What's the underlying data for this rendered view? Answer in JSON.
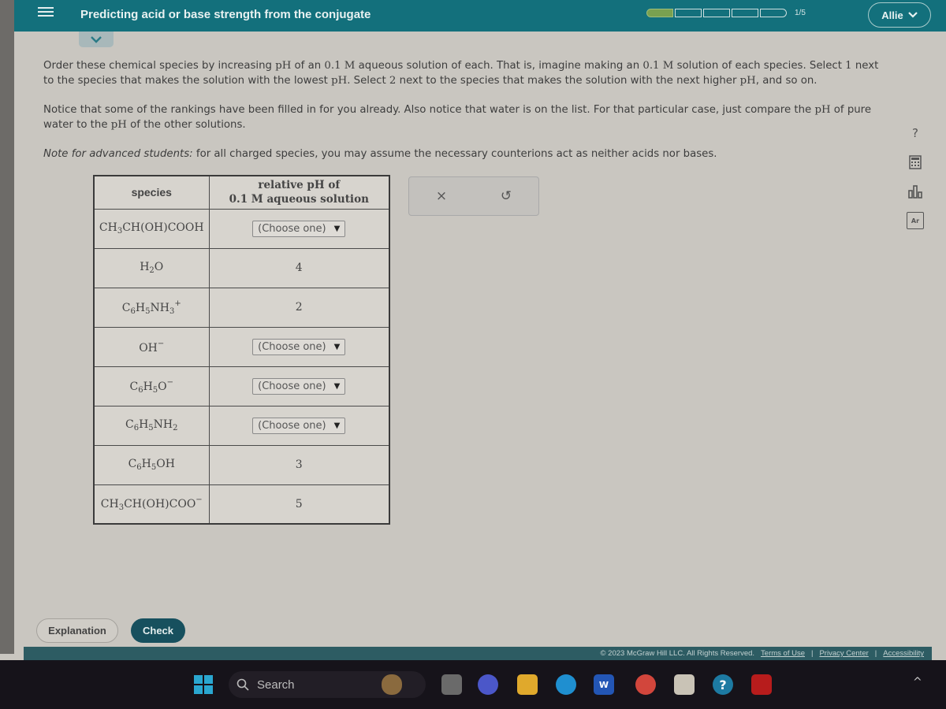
{
  "header": {
    "title": "Predicting acid or base strength from the conjugate",
    "progress": {
      "current": 1,
      "total": 5,
      "label": "1/5"
    },
    "user": "Allie",
    "colors": {
      "header_bg": "#13707c",
      "progress_done": "#79a150",
      "check_button": "#17505e"
    }
  },
  "instructions": {
    "p1_a": "Order these chemical species by increasing ",
    "p1_ph": "pH",
    "p1_b": " of an ",
    "p1_conc": "0.1 M",
    "p1_c": " aqueous solution of each. That is, imagine making an ",
    "p1_conc2": "0.1 M",
    "p1_d": " solution of each species. Select ",
    "p1_one": "1",
    "p1_e": " next to the species that makes the solution with the lowest ",
    "p1_ph2": "pH",
    "p1_f": ". Select ",
    "p1_two": "2",
    "p1_g": " next to the species that makes the solution with the next higher ",
    "p1_ph3": "pH",
    "p1_h": ", and so on.",
    "p2_a": "Notice that some of the rankings have been filled in for you already. Also notice that water is on the list. For that particular case, just compare the ",
    "p2_ph": "pH",
    "p2_b": " of pure water to the ",
    "p2_ph2": "pH",
    "p2_c": " of the other solutions.",
    "p3_italic": "Note for advanced students:",
    "p3_rest": " for all charged species, you may assume the necessary counterions act as neither acids nor bases."
  },
  "table": {
    "col_species": "species",
    "col_ph_line1": "relative pH of",
    "col_ph_line2": "0.1 M aqueous solution",
    "rows": [
      {
        "species": "CH3CH(OH)COOH",
        "value": null,
        "select": "(Choose one)"
      },
      {
        "species": "H2O",
        "value": "4"
      },
      {
        "species": "C6H5NH3+",
        "value": "2"
      },
      {
        "species": "OH-",
        "value": null,
        "select": "(Choose one)"
      },
      {
        "species": "C6H5O-",
        "value": null,
        "select": "(Choose one)"
      },
      {
        "species": "C6H5NH2",
        "value": null,
        "select": "(Choose one)"
      },
      {
        "species": "C6H5OH",
        "value": "3"
      },
      {
        "species": "CH3CH(OH)COO-",
        "value": "5"
      }
    ]
  },
  "tools": {
    "clear": "×",
    "undo": "↺"
  },
  "side_icons": [
    "help-icon",
    "calculator-icon",
    "chart-icon",
    "periodic-table-icon"
  ],
  "buttons": {
    "explanation": "Explanation",
    "check": "Check"
  },
  "footer": {
    "copyright": "© 2023 McGraw Hill LLC. All Rights Reserved.",
    "terms": "Terms of Use",
    "privacy": "Privacy Center",
    "accessibility": "Accessibility"
  },
  "taskbar": {
    "search_placeholder": "Search"
  }
}
